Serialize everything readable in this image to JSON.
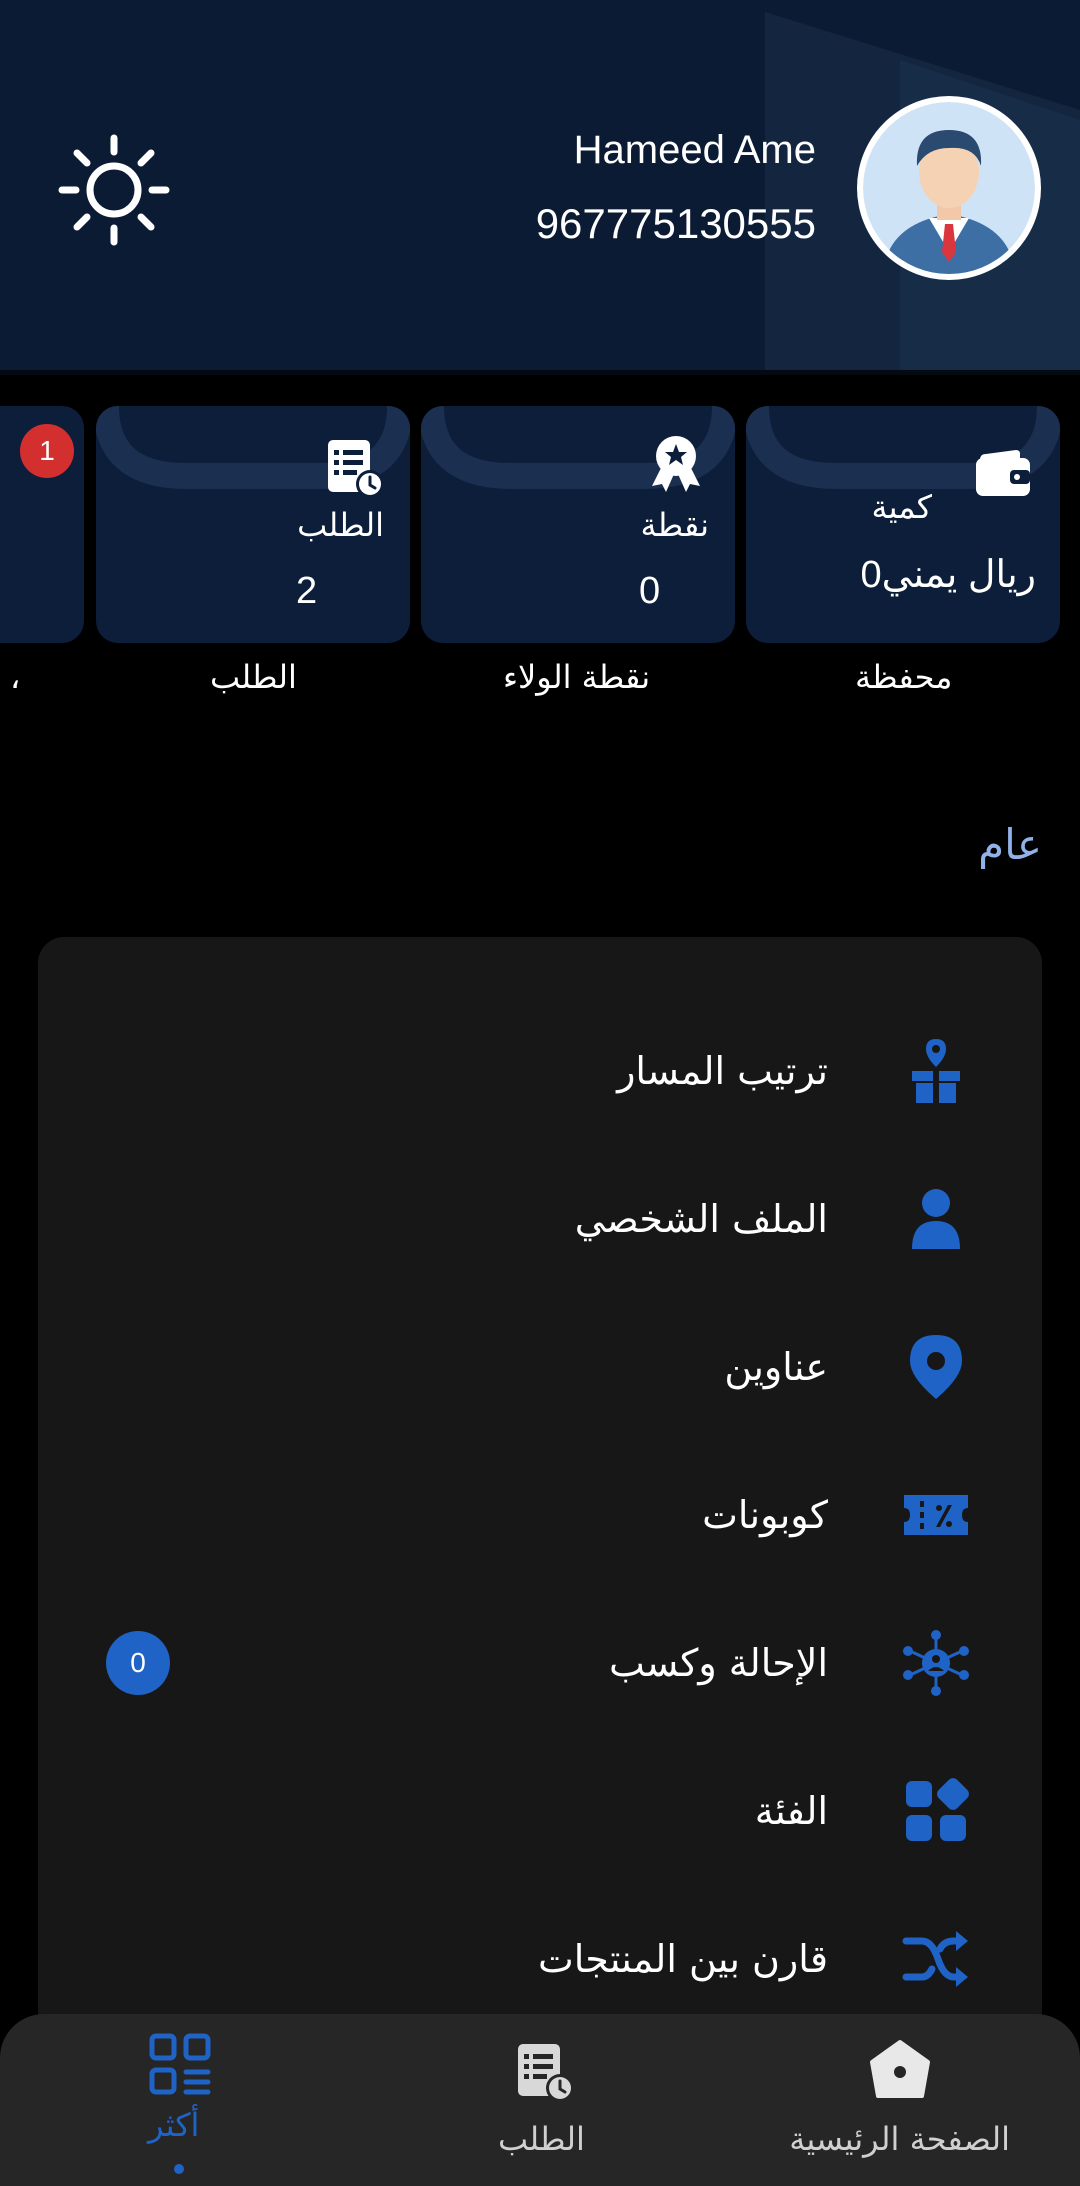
{
  "profile": {
    "name": "Hameed Ame",
    "phone": "967775130555"
  },
  "stats": [
    {
      "label": "كمية",
      "value": "0ريال يمني",
      "caption": "محفظة",
      "icon": "wallet-icon"
    },
    {
      "label": "نقطة",
      "value": "0",
      "caption": "نقطة الولاء",
      "icon": "award-icon"
    },
    {
      "label": "الطلب",
      "value": "2",
      "caption": "الطلب",
      "icon": "order-list-icon"
    },
    {
      "caption": "،",
      "badge": "1"
    }
  ],
  "section": {
    "title": "عام"
  },
  "menu": [
    {
      "label": "ترتيب المسار",
      "icon": "box-location-icon"
    },
    {
      "label": "الملف الشخصي",
      "icon": "person-icon"
    },
    {
      "label": "عناوين",
      "icon": "map-pin-icon"
    },
    {
      "label": "كوبونات",
      "icon": "coupon-icon"
    },
    {
      "label": "الإحالة وكسب",
      "icon": "referral-network-icon",
      "count": "0"
    },
    {
      "label": "الفئة",
      "icon": "category-grid-icon"
    },
    {
      "label": "قارن بين المنتجات",
      "icon": "shuffle-icon"
    }
  ],
  "nav": [
    {
      "label": "الصفحة الرئيسية",
      "icon": "home-icon"
    },
    {
      "label": "الطلب",
      "icon": "order-list-icon"
    },
    {
      "label": "أكثر",
      "icon": "more-grid-icon",
      "active": true
    }
  ],
  "colors": {
    "header_bg": "#0b1b33",
    "card_bg": "#0d1e3a",
    "accent": "#1f63c6",
    "section_title": "#8fb2e8",
    "menu_bg": "#171717",
    "nav_bg": "#262626",
    "badge_red": "#d32f2f"
  }
}
